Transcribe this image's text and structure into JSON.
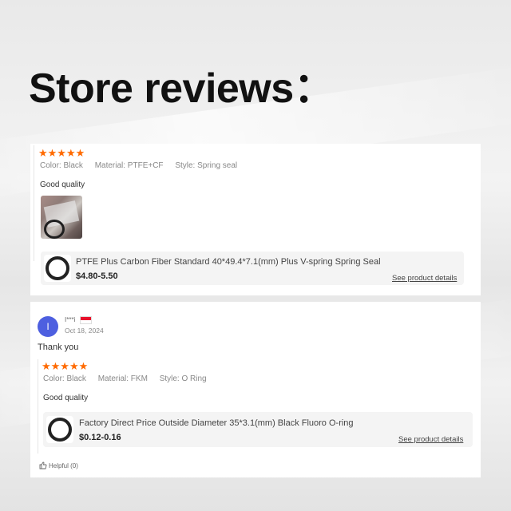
{
  "title": "Store reviews：",
  "review1": {
    "stars": "★★★★★",
    "specs": {
      "color": "Color: Black",
      "material": "Material: PTFE+CF",
      "style": "Style: Spring seal"
    },
    "text": "Good quality",
    "product": {
      "name": "PTFE Plus Carbon Fiber Standard 40*49.4*7.1(mm) Plus V-spring Spring Seal",
      "price": "$4.80-5.50",
      "link": "See product details"
    }
  },
  "review2": {
    "avatar_letter": "I",
    "username": "I***i",
    "date": "Oct 18, 2024",
    "comment": "Thank you",
    "stars": "★★★★★",
    "specs": {
      "color": "Color: Black",
      "material": "Material: FKM",
      "style": "Style: O Ring"
    },
    "text": "Good quality",
    "product": {
      "name": "Factory Direct Price Outside Diameter 35*3.1(mm) Black Fluoro O-ring",
      "price": "$0.12-0.16",
      "link": "See product details"
    },
    "helpful": "Helpful (0)"
  }
}
